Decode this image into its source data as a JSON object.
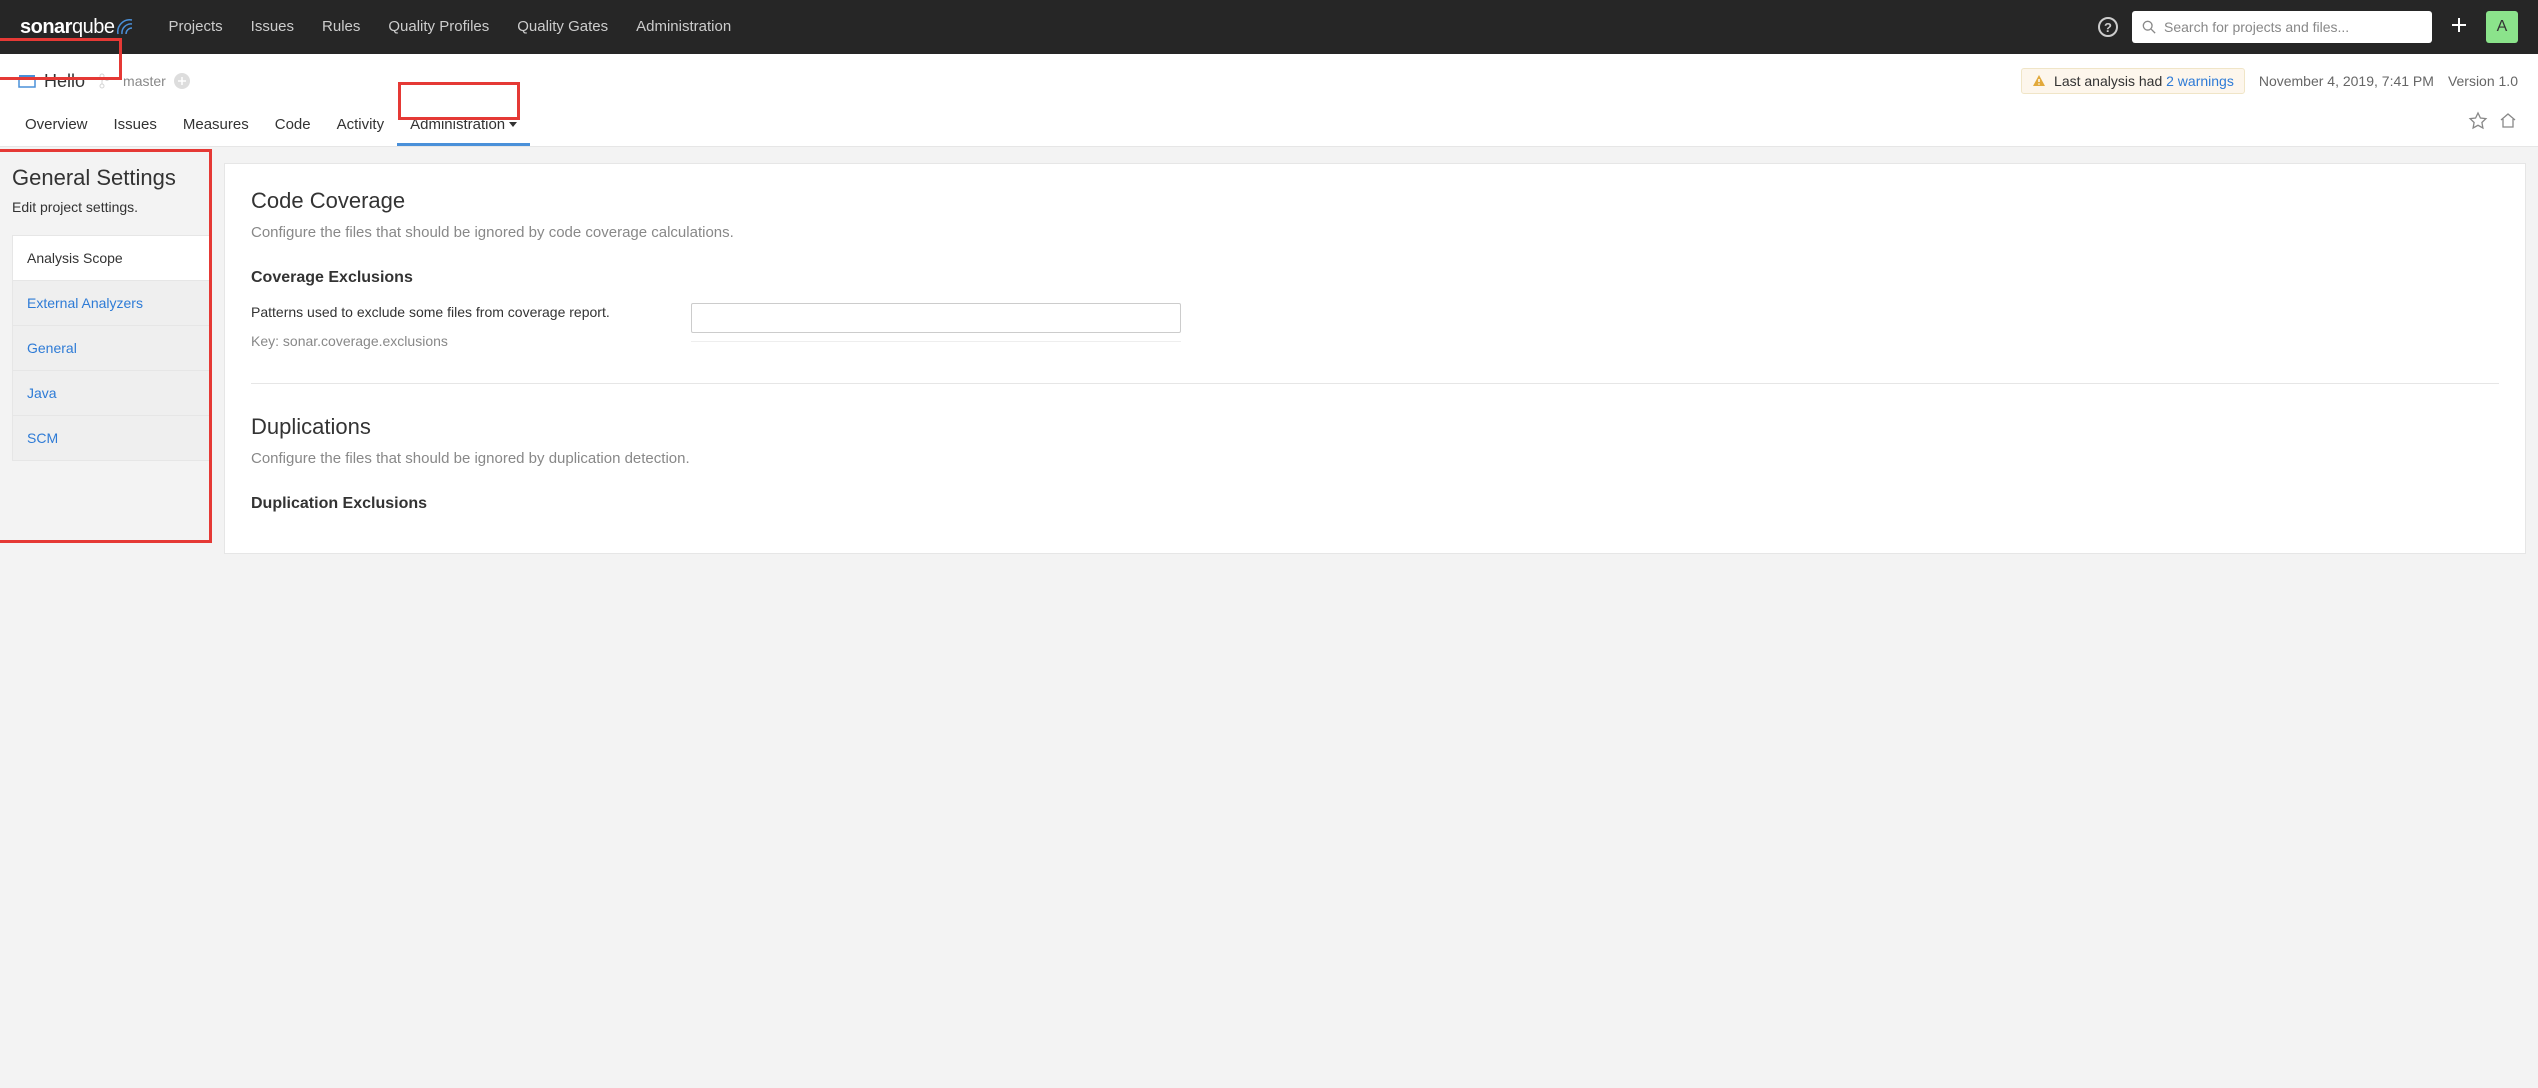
{
  "topnav": {
    "items": [
      "Projects",
      "Issues",
      "Rules",
      "Quality Profiles",
      "Quality Gates",
      "Administration"
    ]
  },
  "search": {
    "placeholder": "Search for projects and files..."
  },
  "avatar": {
    "initial": "A"
  },
  "project": {
    "name": "Hello",
    "branch": "master",
    "warning_prefix": "Last analysis had ",
    "warning_link": "2 warnings",
    "timestamp": "November 4, 2019, 7:41 PM",
    "version": "Version 1.0"
  },
  "projtabs": {
    "items": [
      "Overview",
      "Issues",
      "Measures",
      "Code",
      "Activity",
      "Administration"
    ],
    "active": 5
  },
  "sidebar": {
    "title": "General Settings",
    "subtitle": "Edit project settings.",
    "items": [
      "Analysis Scope",
      "External Analyzers",
      "General",
      "Java",
      "SCM"
    ],
    "active": 0
  },
  "sections": [
    {
      "title": "Code Coverage",
      "desc": "Configure the files that should be ignored by code coverage calculations.",
      "sub": "Coverage Exclusions",
      "field_desc": "Patterns used to exclude some files from coverage report.",
      "field_key": "Key: sonar.coverage.exclusions"
    },
    {
      "title": "Duplications",
      "desc": "Configure the files that should be ignored by duplication detection.",
      "sub": "Duplication Exclusions"
    }
  ]
}
